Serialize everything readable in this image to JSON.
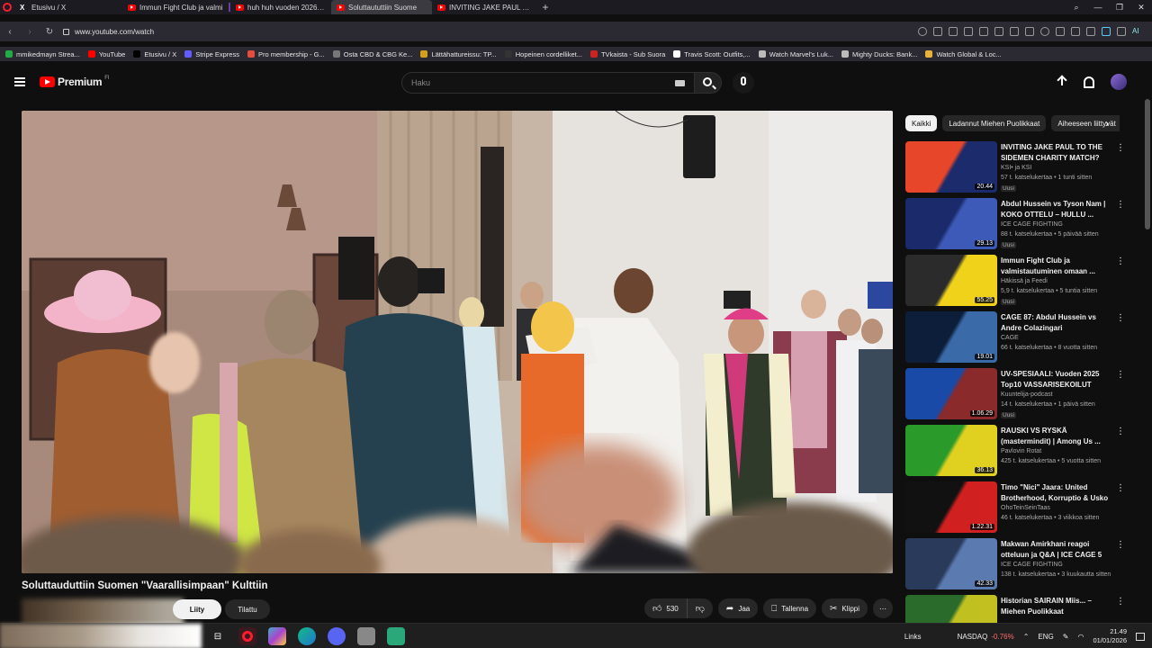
{
  "browser": {
    "tabs": [
      {
        "label": "Etusivu / X",
        "icon": "x-icon",
        "active": false
      },
      {
        "label": "Immun Fight Club ja valmi",
        "icon": "youtube-icon",
        "active": false
      },
      {
        "label": "huh huh vuoden 2026 eka",
        "icon": "youtube-icon",
        "active": false
      },
      {
        "label": "Soluttaututtiin Suome",
        "icon": "youtube-icon",
        "active": true
      },
      {
        "label": "INVITING JAKE PAUL TO TH",
        "icon": "youtube-icon",
        "active": false
      }
    ],
    "url": "www.youtube.com/watch",
    "bookmarks": [
      {
        "label": "mmikedmayn Strea...",
        "color": "#22aa44"
      },
      {
        "label": "YouTube",
        "color": "#ff0000"
      },
      {
        "label": "Etusivu / X",
        "color": "#000000"
      },
      {
        "label": "Stripe Express",
        "color": "#635bff"
      },
      {
        "label": "Pro membership - G...",
        "color": "#e74c3c"
      },
      {
        "label": "Osta CBD & CBG Ke...",
        "color": "#777777"
      },
      {
        "label": "Lättähattureissu: TP...",
        "color": "#d4a017"
      },
      {
        "label": "Hopeinen cordelliket...",
        "color": "#333333"
      },
      {
        "label": "TVkaista - Sub Suora",
        "color": "#cc2222"
      },
      {
        "label": "Travis Scott: Outfits,...",
        "color": "#ffffff"
      },
      {
        "label": "Watch Marvel's Luk...",
        "color": "#bbbbbb"
      },
      {
        "label": "Mighty Ducks: Bank...",
        "color": "#bbbbbb"
      },
      {
        "label": "Watch Global & Loc...",
        "color": "#e8b23a"
      }
    ]
  },
  "header": {
    "logo_text": "Premium",
    "region": "FI",
    "search_placeholder": "Haku"
  },
  "video": {
    "title": "Soluttauduttiin Suomen \"Vaarallisimpaan\" Kulttiin",
    "join_label": "Liity",
    "subscribed_label": "Tilattu",
    "likes": "530",
    "share_label": "Jaa",
    "save_label": "Tallenna",
    "clip_label": "Klippi"
  },
  "sidebar": {
    "chips": [
      "Kaikki",
      "Ladannut Miehen Puolikkaat",
      "Aiheeseen liittyvät"
    ],
    "recommendations": [
      {
        "title": "INVITING JAKE PAUL TO THE SIDEMEN CHARITY MATCH?",
        "channel": "KSI• ja KSI",
        "meta": "57 t. katselukertaa • 1 tunti sitten",
        "badge": "Uusi",
        "duration": "20.44",
        "colors": [
          "#e8462a",
          "#1c2b6b"
        ]
      },
      {
        "title": "Abdul Hussein vs Tyson Nam | KOKO OTTELU – HULLU ...",
        "channel": "ICE CAGE FIGHTING",
        "meta": "88 t. katselukertaa • 5 päivää sitten",
        "badge": "Uusi",
        "duration": "29.13",
        "colors": [
          "#1a2a6a",
          "#3e5ab8"
        ]
      },
      {
        "title": "Immun Fight Club ja valmistautuminen omaan ...",
        "channel": "Häkissä ja Feedi",
        "meta": "5,9 t. katselukertaa • 5 tuntia sitten",
        "badge": "Uusi",
        "duration": "55.25",
        "colors": [
          "#2b2b2b",
          "#f0d21a"
        ]
      },
      {
        "title": "CAGE 87: Abdul Hussein vs Andre Colazingari",
        "channel": "CAGE",
        "meta": "66 t. katselukertaa • 8 vuotta sitten",
        "badge": "",
        "duration": "19.01",
        "colors": [
          "#0c1e3a",
          "#3a6aa8"
        ]
      },
      {
        "title": "UV-SPESIAALI: Vuoden 2025 Top10 VASSARISEKOILUT",
        "channel": "Kuuntelija-podcast",
        "meta": "14 t. katselukertaa • 1 päivä sitten",
        "badge": "Uusi",
        "duration": "1.06.29",
        "colors": [
          "#1a4aa8",
          "#8a2a2a"
        ]
      },
      {
        "title": "RAUSKI VS RYSKÄ (mastermindit) | Among Us ...",
        "channel": "Pavlovin Rotat",
        "meta": "425 t. katselukertaa • 5 vuotta sitten",
        "badge": "",
        "duration": "36.13",
        "colors": [
          "#2a9a2a",
          "#e0d020"
        ]
      },
      {
        "title": "Timo \"Nici\" Jaara: United Brotherhood, Korruptio & Usko",
        "channel": "OhoTeinSeinTaas",
        "meta": "46 t. katselukertaa • 3 viikkoa sitten",
        "badge": "",
        "duration": "1.22.31",
        "colors": [
          "#111111",
          "#d02020"
        ]
      },
      {
        "title": "Makwan Amirkhani reagoi otteluun ja Q&A | ICE CAGE 5",
        "channel": "ICE CAGE FIGHTING",
        "meta": "138 t. katselukertaa • 3 kuukautta sitten",
        "badge": "",
        "duration": "42.33",
        "colors": [
          "#2a3a5a",
          "#5a7ab0"
        ]
      },
      {
        "title": "Historian SAIRAIN Miis... – Miehen Puolikkaat",
        "channel": "",
        "meta": "",
        "badge": "",
        "duration": "",
        "colors": [
          "#2a6a2a",
          "#c0c020"
        ]
      }
    ]
  },
  "taskbar": {
    "links_label": "Links",
    "ticker_name": "NASDAQ",
    "ticker_change": "-0.76%",
    "language": "ENG",
    "time": "21.49",
    "date": "01/01/2026",
    "icons": [
      "task-view-icon",
      "opera-icon",
      "palette-icon",
      "edge-icon",
      "discord-icon",
      "shield-icon",
      "terminal-icon"
    ]
  }
}
